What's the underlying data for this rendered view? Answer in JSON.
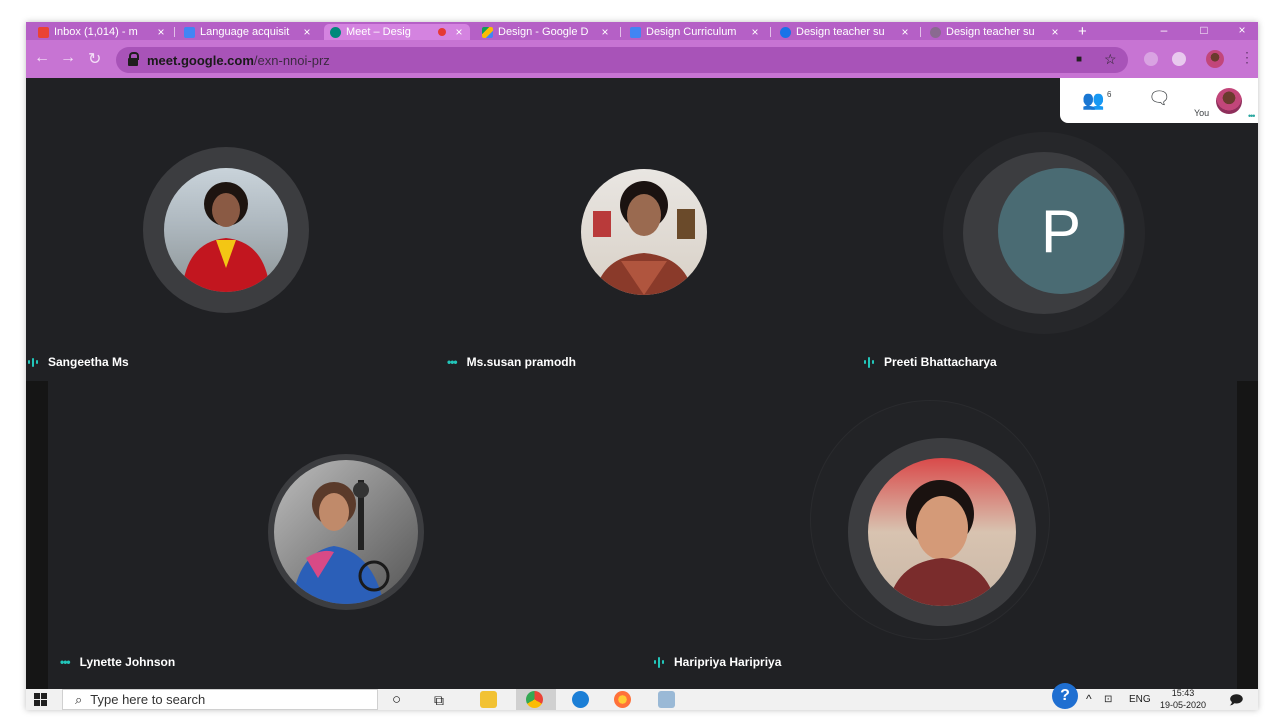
{
  "browser": {
    "tabs": [
      {
        "title": "Inbox (1,014) - m",
        "favicon_color": "#ea4335",
        "active": false
      },
      {
        "title": "Language acquisit",
        "favicon_color": "#4285f4",
        "active": false
      },
      {
        "title": "Meet – Desig",
        "favicon_color": "#00897b",
        "active": true,
        "recording": true
      },
      {
        "title": "Design - Google D",
        "favicon_color": "#fbbc04",
        "active": false
      },
      {
        "title": "Design Curriculum",
        "favicon_color": "#4285f4",
        "active": false
      },
      {
        "title": "Design teacher su",
        "favicon_color": "#1a73e8",
        "active": false
      },
      {
        "title": "Design teacher su",
        "favicon_color": "#757575",
        "active": false
      }
    ],
    "close_glyph": "×",
    "new_tab_glyph": "+",
    "window_controls": {
      "minimize": "–",
      "maximize": "□",
      "close": "×"
    },
    "url_host": "meet.google.com",
    "url_path": "/exn-nnoi-prz",
    "icons": {
      "back": "←",
      "forward": "→",
      "reload": "↻",
      "camera": "■",
      "star": "☆"
    },
    "accent_color": "#c774d3"
  },
  "meet": {
    "top_panel": {
      "participants_count": "6",
      "people_icon": "👥",
      "chat_icon": "🗨",
      "self_label": "You"
    },
    "participants": [
      {
        "name": "Sangeetha Ms",
        "indicator": "speaking"
      },
      {
        "name": "Ms.susan pramodh",
        "indicator": "muted-dots"
      },
      {
        "name": "Preeti Bhattacharya",
        "indicator": "speaking",
        "initial": "P"
      },
      {
        "name": "Lynette Johnson",
        "indicator": "muted-dots"
      },
      {
        "name": "Haripriya Haripriya",
        "indicator": "speaking"
      }
    ],
    "dots_glyph": "•••",
    "indicator_color": "#22c6ba"
  },
  "taskbar": {
    "search_placeholder": "Type here to search",
    "search_icon": "⌕",
    "cortana_icon": "○",
    "taskview_icon": "⧉",
    "help_icon": "?",
    "tray_arrow": "^",
    "network_icon": "⊡",
    "language": "ENG",
    "time": "15:43",
    "date": "19-05-2020",
    "notification_icon": "🗩"
  }
}
